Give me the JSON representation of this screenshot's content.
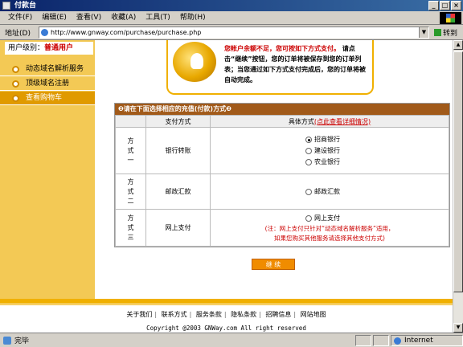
{
  "window": {
    "title": "付款台"
  },
  "menu": [
    "文件(F)",
    "编辑(E)",
    "查看(V)",
    "收藏(A)",
    "工具(T)",
    "帮助(H)"
  ],
  "address": {
    "label": "地址(D)",
    "url": "http://www.gnway.com/purchase/purchase.php",
    "go": "转到"
  },
  "sidebar": {
    "user_level_label": "用户级别：",
    "user_level_value": "普通用户",
    "items": [
      {
        "label": "动态域名解析服务",
        "active": false
      },
      {
        "label": "顶级域名注册",
        "active": false
      },
      {
        "label": "查看购物车",
        "active": true
      }
    ]
  },
  "notice": {
    "warning": "您帐户余额不足，您可按如下方式支付。",
    "body": "请点击“继续”按钮，您的订单将被保存到您的订单列表；当您通过如下方式支付完成后，您的订单将被自动完成。"
  },
  "pay_table": {
    "header": "❷请在下面选择相应的充值(付款)方式❷",
    "col_method": "支付方式",
    "col_detail": "具体方式",
    "col_detail_link": "(点此查看详细情况)",
    "rows": [
      {
        "label": "方\n式\n一",
        "name": "银行转账",
        "options": [
          "招商银行",
          "建设银行",
          "农业银行"
        ],
        "selected": 0
      },
      {
        "label": "方\n式\n二",
        "name": "邮政汇款",
        "options": [
          "邮政汇款"
        ],
        "selected": -1
      },
      {
        "label": "方\n式\n三",
        "name": "网上支付",
        "options": [
          "网上支付"
        ],
        "selected": -1,
        "note": "(注：网上支付只针对“动态域名解析服务”适用，\n如果您购买其他服务请选择其他支付方式)"
      }
    ]
  },
  "submit_label": "继  续",
  "footer": {
    "links": [
      "关于我们",
      "联系方式",
      "服务条款",
      "隐私条款",
      "招聘信息",
      "网站地图"
    ],
    "copyright": "Copyright @2003 GNWay.com All right reserved"
  },
  "status": {
    "text": "完毕",
    "zone": "Internet"
  }
}
